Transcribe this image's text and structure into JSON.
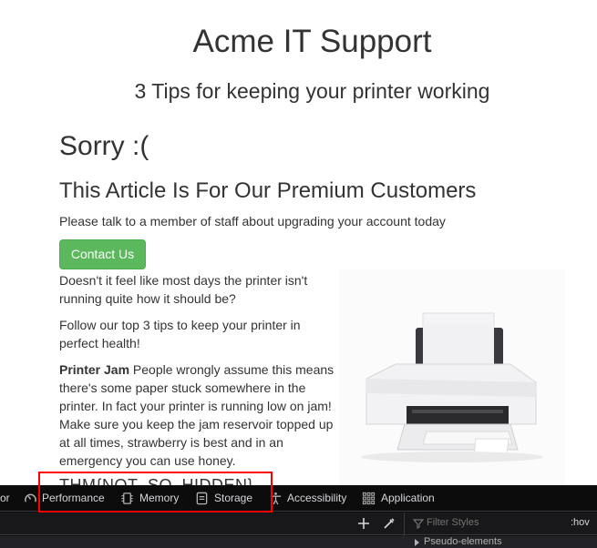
{
  "site": {
    "title": "Acme IT Support",
    "subtitle": "3 Tips for keeping your printer working"
  },
  "notice": {
    "sorry": "Sorry :(",
    "heading": "This Article Is For Our Premium Customers",
    "message": "Please talk to a member of staff about upgrading your account today",
    "contact_button": "Contact Us"
  },
  "article": {
    "p1": "Doesn't it feel like most days the printer isn't running quite how it should be?",
    "p2": "Follow our top 3 tips to keep your printer in perfect health!",
    "p3_bold": "Printer Jam",
    "p3_rest": " People wrongly assume this means there's some paper stuck somewhere in the printer. In fact your printer is running low on jam! Make sure you keep the jam reservoir topped up at all times, strawberry is best and in an emergency you can use honey.",
    "cut_heading": "THM{NOT_SO_HIDDEN}"
  },
  "devtools": {
    "tab_partial": "or",
    "tabs": [
      "Performance",
      "Memory",
      "Storage",
      "Accessibility",
      "Application"
    ],
    "filter_placeholder": "Filter Styles",
    "hov": ":hov",
    "pseudo": "Pseudo-elements"
  }
}
